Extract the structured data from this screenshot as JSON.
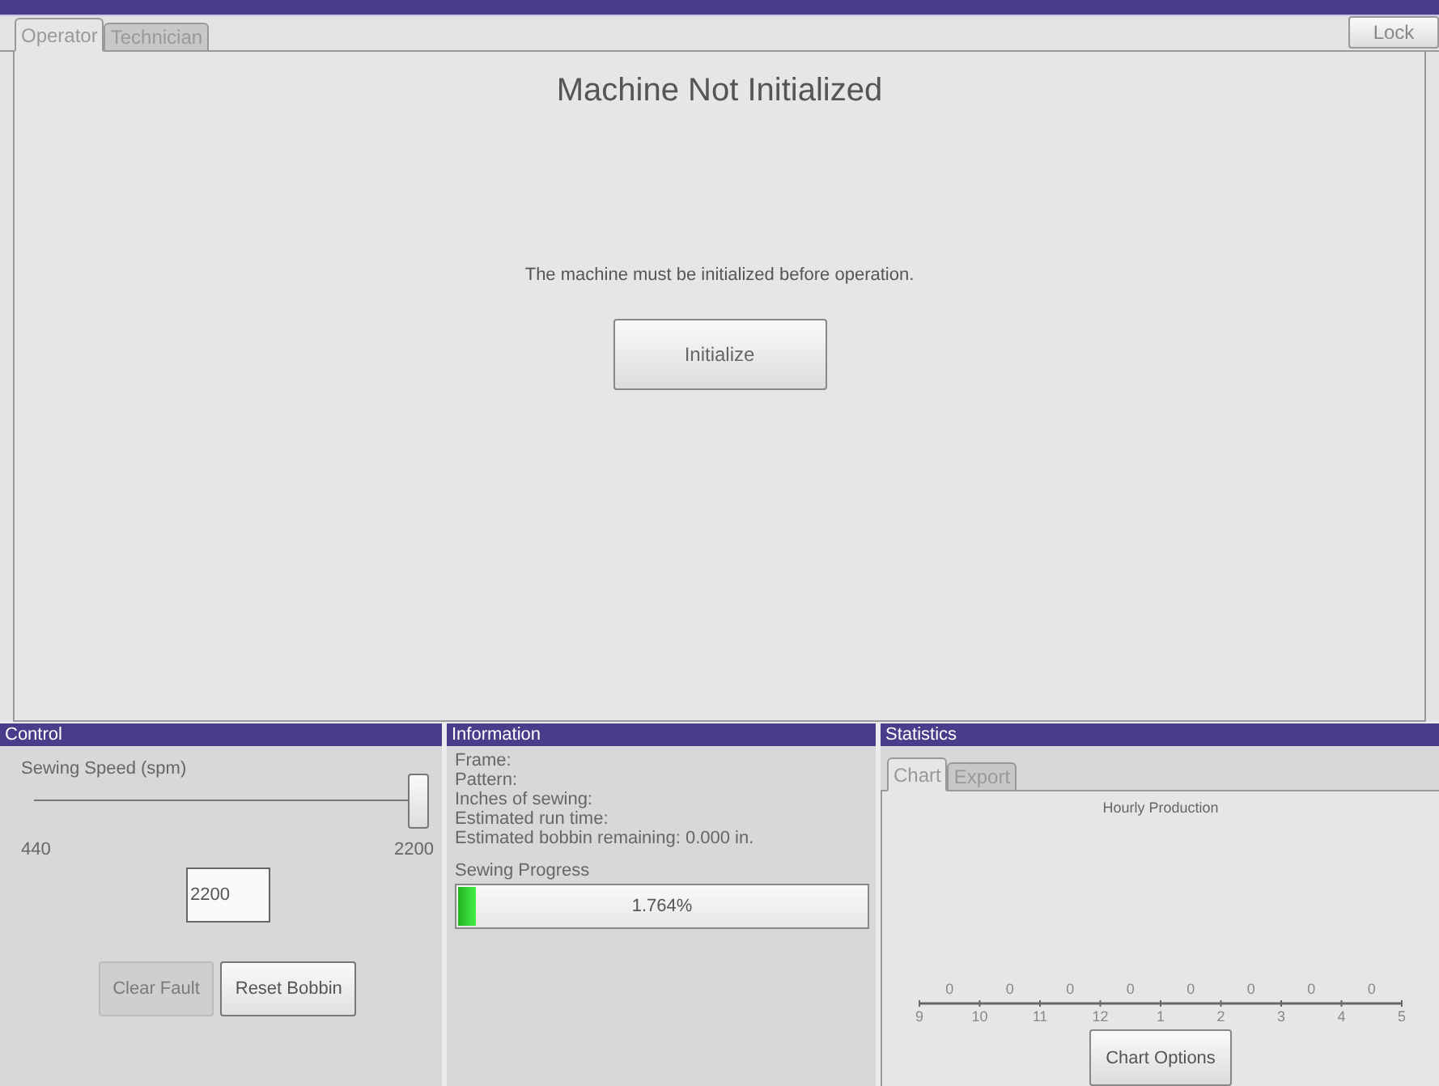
{
  "tabs": [
    {
      "label": "Operator",
      "selected": true
    },
    {
      "label": "Technician",
      "selected": false
    }
  ],
  "lock_button": "Lock",
  "main": {
    "title": "Machine Not Initialized",
    "message": "The machine must be initialized before operation.",
    "initialize_button": "Initialize"
  },
  "control": {
    "title": "Control",
    "speed_label": "Sewing Speed (spm)",
    "slider": {
      "level": 1.0,
      "min_label": "440",
      "max_label": "2200"
    },
    "speed_value": "2200",
    "buttons": [
      {
        "label": "Clear Fault",
        "disabled": true
      },
      {
        "label": "Reset Bobbin",
        "disabled": false
      }
    ]
  },
  "information": {
    "title": "Information",
    "lines": [
      "Frame:",
      "Pattern:",
      "Inches of sewing:",
      "Estimated run time:",
      "Estimated bobbin remaining: 0.000 in."
    ],
    "progress_label": "Sewing Progress",
    "progress": {
      "level": 0.045,
      "reading": "1.764%"
    }
  },
  "statistics": {
    "title": "Statistics",
    "tabs": [
      {
        "label": "Chart",
        "selected": true
      },
      {
        "label": "Export",
        "selected": false
      }
    ],
    "hourly_production": {
      "title": "Hourly Production",
      "counts": [
        "0",
        "0",
        "0",
        "0",
        "0",
        "0",
        "0",
        "0"
      ],
      "hours": [
        "9",
        "10",
        "11",
        "12",
        "1",
        "2",
        "3",
        "4",
        "5"
      ]
    },
    "chart_options_button": "Chart Options"
  }
}
